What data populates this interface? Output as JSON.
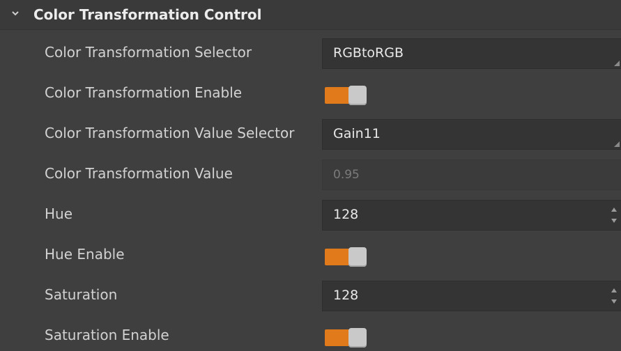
{
  "group": {
    "title": "Color Transformation Control",
    "expanded": true
  },
  "rows": [
    {
      "label": "Color Transformation Selector",
      "type": "dropdown",
      "value": "RGBtoRGB"
    },
    {
      "label": "Color Transformation Enable",
      "type": "toggle",
      "on": true
    },
    {
      "label": "Color Transformation Value Selector",
      "type": "dropdown",
      "value": "Gain11"
    },
    {
      "label": "Color Transformation Value",
      "type": "readonly",
      "value": "0.95"
    },
    {
      "label": "Hue",
      "type": "spinbox",
      "value": "128"
    },
    {
      "label": "Hue Enable",
      "type": "toggle",
      "on": true
    },
    {
      "label": "Saturation",
      "type": "spinbox",
      "value": "128"
    },
    {
      "label": "Saturation Enable",
      "type": "toggle",
      "on": true
    }
  ],
  "colors": {
    "background": "#3f3f3f",
    "toggle_on": "#e07a1a",
    "field_bg": "#343434"
  },
  "icons": {
    "group_toggle": "chevron-down-icon",
    "dropdown": "resize-grip-icon",
    "spin": "spin-arrows-icon"
  }
}
